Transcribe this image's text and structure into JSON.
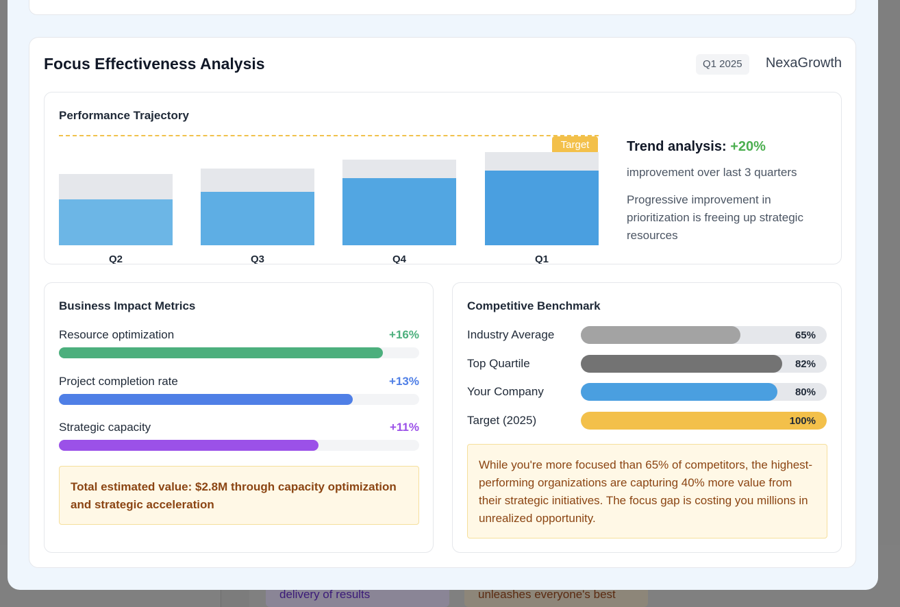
{
  "background": {
    "card_left_text": "delivery of results",
    "card_right_text": "unleashes everyone's best"
  },
  "section": {
    "title": "Focus Effectiveness Analysis",
    "quarter_badge": "Q1 2025",
    "brand": "NexaGrowth"
  },
  "performance": {
    "title": "Performance Trajectory",
    "target_label": "Target",
    "bars": [
      {
        "label": "Q2",
        "value": 42,
        "capacity": 65,
        "color": "#6cb6e6"
      },
      {
        "label": "Q3",
        "value": 49,
        "capacity": 70,
        "color": "#5eaee4"
      },
      {
        "label": "Q4",
        "value": 61,
        "capacity": 78,
        "color": "#52a6e2"
      },
      {
        "label": "Q1",
        "value": 68,
        "capacity": 85,
        "color": "#4a9fe0"
      }
    ],
    "trend_label": "Trend analysis:",
    "trend_value": "+20%",
    "trend_sub": "improvement over last 3 quarters",
    "trend_desc": "Progressive improvement in prioritization is freeing up strategic resources"
  },
  "metrics": {
    "title": "Business Impact Metrics",
    "items": [
      {
        "label": "Resource optimization",
        "value": "+16%",
        "fill": 0.9,
        "color": "#4caf7d"
      },
      {
        "label": "Project completion rate",
        "value": "+13%",
        "fill": 0.815,
        "color": "#4f7fe6"
      },
      {
        "label": "Strategic capacity",
        "value": "+11%",
        "fill": 0.72,
        "color": "#9b51e8"
      }
    ],
    "note": "Total estimated value: $2.8M through capacity optimization and strategic acceleration"
  },
  "benchmark": {
    "title": "Competitive Benchmark",
    "rows": [
      {
        "label": "Industry Average",
        "value": "65%",
        "fill": 0.65,
        "color": "#a3a3a3"
      },
      {
        "label": "Top Quartile",
        "value": "82%",
        "fill": 0.82,
        "color": "#737373"
      },
      {
        "label": "Your Company",
        "value": "80%",
        "fill": 0.8,
        "color": "#4a9fe0"
      },
      {
        "label": "Target (2025)",
        "value": "100%",
        "fill": 1.0,
        "color": "#f3c04a"
      }
    ],
    "note": "While you're more focused than 65% of competitors, the highest-performing organizations are capturing 40% more value from their strategic initiatives. The focus gap is costing you millions in unrealized opportunity."
  }
}
